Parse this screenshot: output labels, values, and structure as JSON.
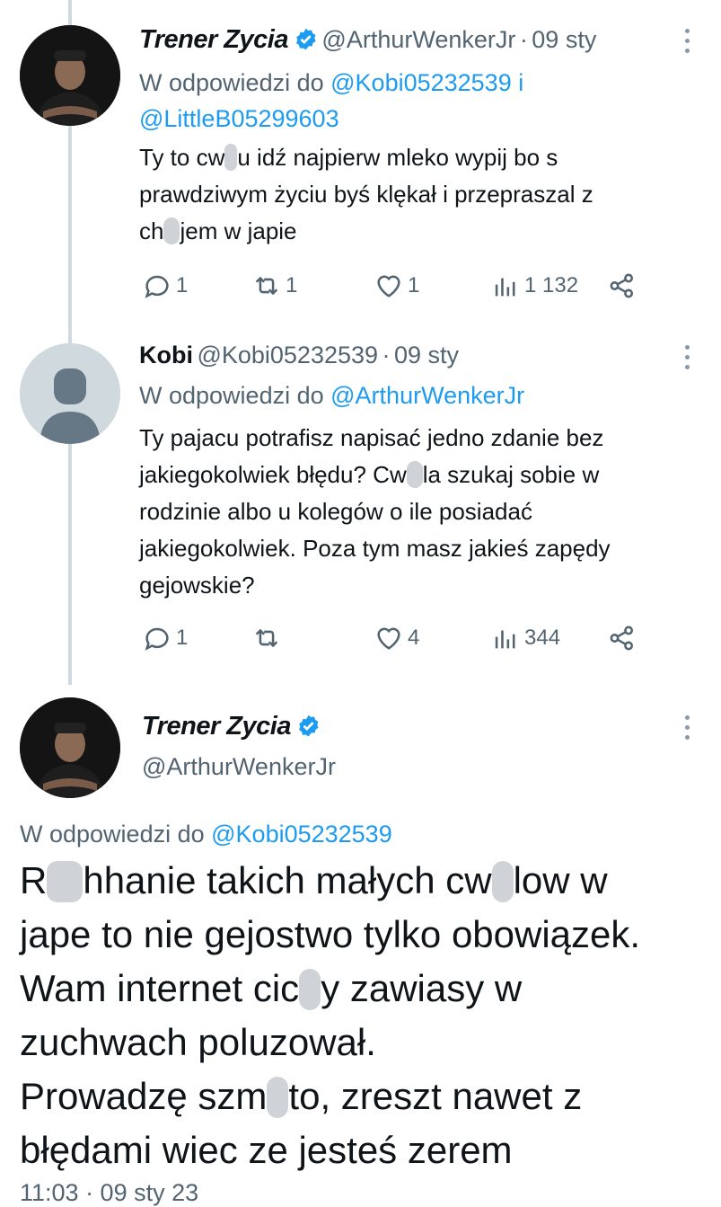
{
  "tweets": [
    {
      "name": "Trener Zycia",
      "handle": "@ArthurWenkerJr",
      "date": "09 sty",
      "reply_prefix": "W odpowiedzi do",
      "reply_mention1": "@Kobi05232539",
      "reply_and": "i",
      "reply_mention2": "@LittleB05299603",
      "text": {
        "l1a": "Ty to cw",
        "l1b": "u idź najpierw mleko wypij bo s",
        "l2": "prawdziwym życiu byś klękał i przepraszal z",
        "l3a": "ch",
        "l3b": "jem w japie"
      },
      "stats": {
        "replies": "1",
        "retweets": "1",
        "likes": "1",
        "views": "1 132"
      }
    },
    {
      "name": "Kobi",
      "handle": "@Kobi05232539",
      "date": "09 sty",
      "reply_prefix": "W odpowiedzi do",
      "reply_mention1": "@ArthurWenkerJr",
      "text": {
        "l1": "Ty pajacu potrafisz napisać jedno zdanie bez",
        "l2a": "jakiegokolwiek błędu? Cw",
        "l2b": "la szukaj sobie w",
        "l3": "rodzinie albo u kolegów o ile posiadać",
        "l4": "jakiegokolwiek. Poza tym masz jakieś zapędy",
        "l5": "gejowskie?"
      },
      "stats": {
        "replies": "1",
        "retweets": "",
        "likes": "4",
        "views": "344"
      }
    }
  ],
  "main_tweet": {
    "name": "Trener Zycia",
    "handle": "@ArthurWenkerJr",
    "reply_prefix": "W odpowiedzi do",
    "reply_mention": "@Kobi05232539",
    "text": {
      "l1a": "R",
      "l1b": "hhanie takich małych cw",
      "l1c": "low w",
      "l2": "jape to nie gejostwo tylko obowiązek.",
      "l3a": "Wam internet cic",
      "l3b": "y zawiasy w",
      "l4": "zuchwach poluzował.",
      "l5a": "Prowadzę szm",
      "l5b": "to, zreszt nawet z",
      "l6": "błędami wiec ze jesteś zerem"
    },
    "timestamp": "11:03 · 09 sty 23"
  }
}
